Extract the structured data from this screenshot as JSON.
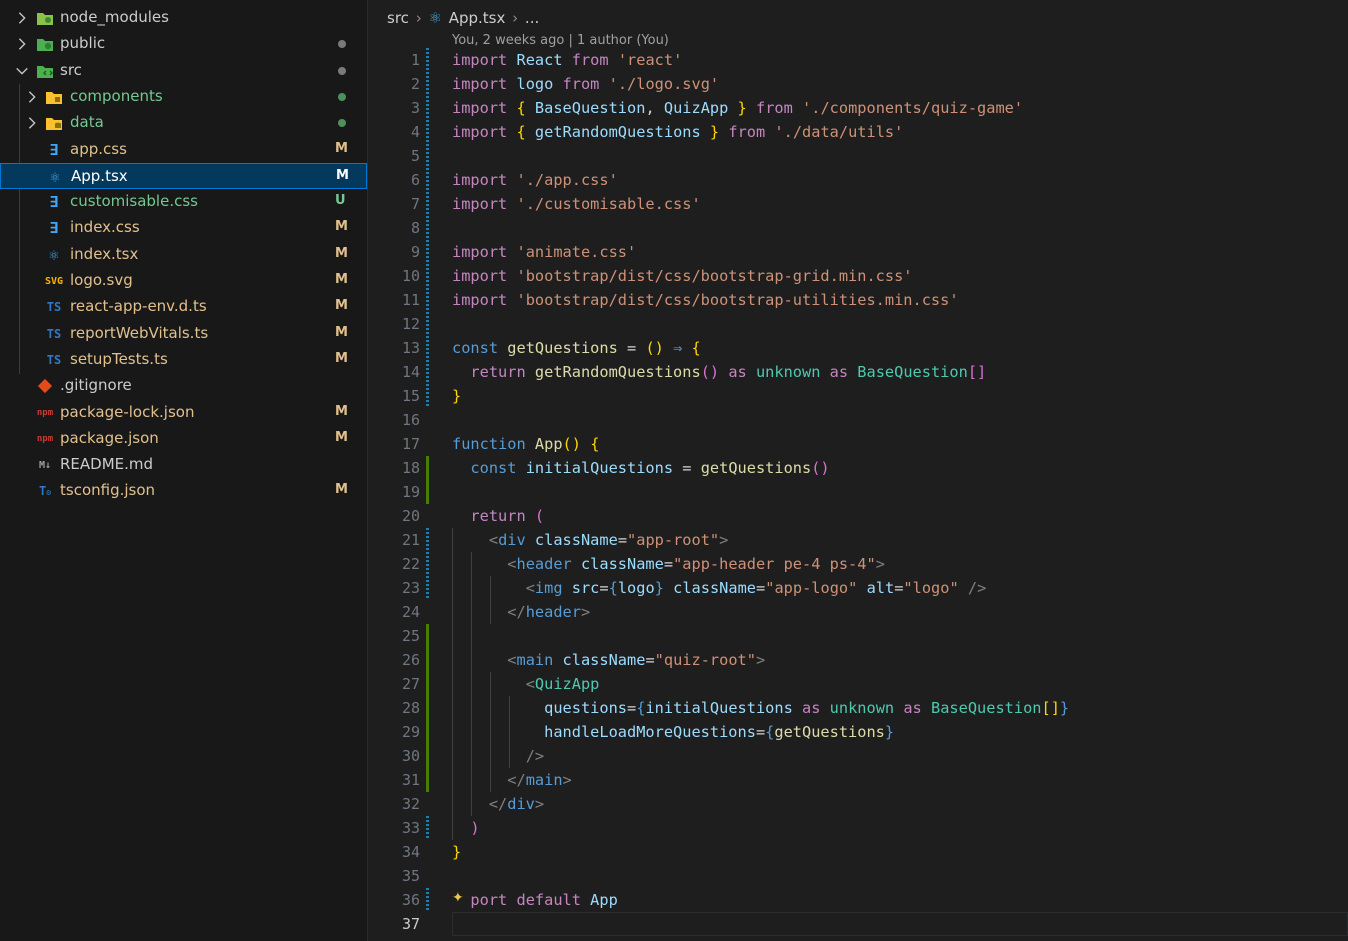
{
  "sidebar": {
    "items": [
      {
        "name": "node_modules",
        "kind": "folder",
        "icon": "folder-node-icon",
        "collapsed": true,
        "badge": "",
        "dot": false
      },
      {
        "name": "public",
        "kind": "folder",
        "icon": "folder-public-icon",
        "collapsed": true,
        "badge": "",
        "dot": true
      },
      {
        "name": "src",
        "kind": "folder",
        "icon": "folder-src-icon",
        "collapsed": false,
        "badge": "",
        "dot": true
      },
      {
        "name": "components",
        "kind": "folder",
        "icon": "folder-components-icon",
        "collapsed": true,
        "badge": "",
        "dot": true
      },
      {
        "name": "data",
        "kind": "folder",
        "icon": "folder-data-icon",
        "collapsed": true,
        "badge": "",
        "dot": true
      },
      {
        "name": "app.css",
        "kind": "file",
        "icon": "css-icon",
        "badge": "M"
      },
      {
        "name": "App.tsx",
        "kind": "file",
        "icon": "react-icon",
        "badge": "M",
        "selected": true
      },
      {
        "name": "customisable.css",
        "kind": "file",
        "icon": "css-icon",
        "badge": "U"
      },
      {
        "name": "index.css",
        "kind": "file",
        "icon": "css-icon",
        "badge": "M"
      },
      {
        "name": "index.tsx",
        "kind": "file",
        "icon": "react-icon",
        "badge": "M"
      },
      {
        "name": "logo.svg",
        "kind": "file",
        "icon": "svg-icon",
        "badge": "M"
      },
      {
        "name": "react-app-env.d.ts",
        "kind": "file",
        "icon": "typescript-icon",
        "badge": "M"
      },
      {
        "name": "reportWebVitals.ts",
        "kind": "file",
        "icon": "typescript-icon",
        "badge": "M"
      },
      {
        "name": "setupTests.ts",
        "kind": "file",
        "icon": "typescript-icon",
        "badge": "M"
      },
      {
        "name": ".gitignore",
        "kind": "file",
        "icon": "git-icon",
        "badge": ""
      },
      {
        "name": "package-lock.json",
        "kind": "file",
        "icon": "npm-icon",
        "badge": "M"
      },
      {
        "name": "package.json",
        "kind": "file",
        "icon": "npm-icon",
        "badge": "M"
      },
      {
        "name": "README.md",
        "kind": "file",
        "icon": "markdown-icon",
        "badge": ""
      },
      {
        "name": "tsconfig.json",
        "kind": "file",
        "icon": "tsconfig-icon",
        "badge": "M"
      }
    ]
  },
  "editor": {
    "breadcrumb": [
      "src",
      "App.tsx",
      "..."
    ],
    "blame": "You, 2 weeks ago | 1 author (You)",
    "active_line": 37,
    "lines": [
      [
        [
          "k",
          "import"
        ],
        [
          "p",
          " "
        ],
        [
          "v",
          "React"
        ],
        [
          "p",
          " "
        ],
        [
          "k",
          "from"
        ],
        [
          "p",
          " "
        ],
        [
          "s",
          "'react'"
        ]
      ],
      [
        [
          "k",
          "import"
        ],
        [
          "p",
          " "
        ],
        [
          "v",
          "logo"
        ],
        [
          "p",
          " "
        ],
        [
          "k",
          "from"
        ],
        [
          "p",
          " "
        ],
        [
          "s",
          "'./logo.svg'"
        ]
      ],
      [
        [
          "k",
          "import"
        ],
        [
          "p",
          " "
        ],
        [
          "y",
          "{"
        ],
        [
          "p",
          " "
        ],
        [
          "v",
          "BaseQuestion"
        ],
        [
          "p",
          ", "
        ],
        [
          "v",
          "QuizApp"
        ],
        [
          "p",
          " "
        ],
        [
          "y",
          "}"
        ],
        [
          "p",
          " "
        ],
        [
          "k",
          "from"
        ],
        [
          "p",
          " "
        ],
        [
          "s",
          "'./components/quiz-game'"
        ]
      ],
      [
        [
          "k",
          "import"
        ],
        [
          "p",
          " "
        ],
        [
          "y",
          "{"
        ],
        [
          "p",
          " "
        ],
        [
          "v",
          "getRandomQuestions"
        ],
        [
          "p",
          " "
        ],
        [
          "y",
          "}"
        ],
        [
          "p",
          " "
        ],
        [
          "k",
          "from"
        ],
        [
          "p",
          " "
        ],
        [
          "s",
          "'./data/utils'"
        ]
      ],
      [],
      [
        [
          "k",
          "import"
        ],
        [
          "p",
          " "
        ],
        [
          "s",
          "'./app.css'"
        ]
      ],
      [
        [
          "k",
          "import"
        ],
        [
          "p",
          " "
        ],
        [
          "s",
          "'./customisable.css'"
        ]
      ],
      [],
      [
        [
          "k",
          "import"
        ],
        [
          "p",
          " "
        ],
        [
          "s",
          "'animate.css'"
        ]
      ],
      [
        [
          "k",
          "import"
        ],
        [
          "p",
          " "
        ],
        [
          "s",
          "'bootstrap/dist/css/bootstrap-grid.min.css'"
        ]
      ],
      [
        [
          "k",
          "import"
        ],
        [
          "p",
          " "
        ],
        [
          "s",
          "'bootstrap/dist/css/bootstrap-utilities.min.css'"
        ]
      ],
      [],
      [
        [
          "b",
          "const"
        ],
        [
          "p",
          " "
        ],
        [
          "f",
          "getQuestions"
        ],
        [
          "p",
          " = "
        ],
        [
          "y",
          "()"
        ],
        [
          "p",
          " "
        ],
        [
          "b",
          "⇒"
        ],
        [
          "p",
          " "
        ],
        [
          "y",
          "{"
        ]
      ],
      [
        [
          "p",
          "  "
        ],
        [
          "k",
          "return"
        ],
        [
          "p",
          " "
        ],
        [
          "f",
          "getRandomQuestions"
        ],
        [
          "m",
          "()"
        ],
        [
          "p",
          " "
        ],
        [
          "k",
          "as"
        ],
        [
          "p",
          " "
        ],
        [
          "t",
          "unknown"
        ],
        [
          "p",
          " "
        ],
        [
          "k",
          "as"
        ],
        [
          "p",
          " "
        ],
        [
          "t",
          "BaseQuestion"
        ],
        [
          "m",
          "[]"
        ]
      ],
      [
        [
          "y",
          "}"
        ]
      ],
      [],
      [
        [
          "b",
          "function"
        ],
        [
          "p",
          " "
        ],
        [
          "f",
          "App"
        ],
        [
          "y",
          "()"
        ],
        [
          "p",
          " "
        ],
        [
          "y",
          "{"
        ]
      ],
      [
        [
          "p",
          "  "
        ],
        [
          "b",
          "const"
        ],
        [
          "p",
          " "
        ],
        [
          "v",
          "initialQuestions"
        ],
        [
          "p",
          " = "
        ],
        [
          "f",
          "getQuestions"
        ],
        [
          "m",
          "()"
        ]
      ],
      [],
      [
        [
          "p",
          "  "
        ],
        [
          "k",
          "return"
        ],
        [
          "p",
          " "
        ],
        [
          "m",
          "("
        ]
      ],
      [
        [
          "p",
          "    "
        ],
        [
          "g",
          "<"
        ],
        [
          "b",
          "div"
        ],
        [
          "p",
          " "
        ],
        [
          "v",
          "className"
        ],
        [
          "p",
          "="
        ],
        [
          "s",
          "\"app-root\""
        ],
        [
          "g",
          ">"
        ]
      ],
      [
        [
          "p",
          "      "
        ],
        [
          "g",
          "<"
        ],
        [
          "b",
          "header"
        ],
        [
          "p",
          " "
        ],
        [
          "v",
          "className"
        ],
        [
          "p",
          "="
        ],
        [
          "s",
          "\"app-header pe-4 ps-4\""
        ],
        [
          "g",
          ">"
        ]
      ],
      [
        [
          "p",
          "        "
        ],
        [
          "g",
          "<"
        ],
        [
          "b",
          "img"
        ],
        [
          "p",
          " "
        ],
        [
          "v",
          "src"
        ],
        [
          "p",
          "="
        ],
        [
          "b",
          "{"
        ],
        [
          "v",
          "logo"
        ],
        [
          "b",
          "}"
        ],
        [
          "p",
          " "
        ],
        [
          "v",
          "className"
        ],
        [
          "p",
          "="
        ],
        [
          "s",
          "\"app-logo\""
        ],
        [
          "p",
          " "
        ],
        [
          "v",
          "alt"
        ],
        [
          "p",
          "="
        ],
        [
          "s",
          "\"logo\""
        ],
        [
          "p",
          " "
        ],
        [
          "g",
          "/>"
        ]
      ],
      [
        [
          "p",
          "      "
        ],
        [
          "g",
          "</"
        ],
        [
          "b",
          "header"
        ],
        [
          "g",
          ">"
        ]
      ],
      [],
      [
        [
          "p",
          "      "
        ],
        [
          "g",
          "<"
        ],
        [
          "b",
          "main"
        ],
        [
          "p",
          " "
        ],
        [
          "v",
          "className"
        ],
        [
          "p",
          "="
        ],
        [
          "s",
          "\"quiz-root\""
        ],
        [
          "g",
          ">"
        ]
      ],
      [
        [
          "p",
          "        "
        ],
        [
          "g",
          "<"
        ],
        [
          "t",
          "QuizApp"
        ]
      ],
      [
        [
          "p",
          "          "
        ],
        [
          "v",
          "questions"
        ],
        [
          "p",
          "="
        ],
        [
          "b",
          "{"
        ],
        [
          "v",
          "initialQuestions"
        ],
        [
          "p",
          " "
        ],
        [
          "k",
          "as"
        ],
        [
          "p",
          " "
        ],
        [
          "t",
          "unknown"
        ],
        [
          "p",
          " "
        ],
        [
          "k",
          "as"
        ],
        [
          "p",
          " "
        ],
        [
          "t",
          "BaseQuestion"
        ],
        [
          "y",
          "[]"
        ],
        [
          "b",
          "}"
        ]
      ],
      [
        [
          "p",
          "          "
        ],
        [
          "v",
          "handleLoadMoreQuestions"
        ],
        [
          "p",
          "="
        ],
        [
          "b",
          "{"
        ],
        [
          "f",
          "getQuestions"
        ],
        [
          "b",
          "}"
        ]
      ],
      [
        [
          "p",
          "        "
        ],
        [
          "g",
          "/>"
        ]
      ],
      [
        [
          "p",
          "      "
        ],
        [
          "g",
          "</"
        ],
        [
          "b",
          "main"
        ],
        [
          "g",
          ">"
        ]
      ],
      [
        [
          "p",
          "    "
        ],
        [
          "g",
          "</"
        ],
        [
          "b",
          "div"
        ],
        [
          "g",
          ">"
        ]
      ],
      [
        [
          "p",
          "  "
        ],
        [
          "m",
          ")"
        ]
      ],
      [
        [
          "y",
          "}"
        ]
      ],
      [],
      [
        [
          "p",
          "  "
        ],
        [
          "k",
          "port"
        ],
        [
          "p",
          " "
        ],
        [
          "k",
          "default"
        ],
        [
          "p",
          " "
        ],
        [
          "v",
          "App"
        ]
      ],
      []
    ],
    "gutter": [
      "mod",
      "mod",
      "mod",
      "mod",
      "mod",
      "mod",
      "mod",
      "mod",
      "mod",
      "mod",
      "mod",
      "mod",
      "mod",
      "mod",
      "mod",
      "",
      "",
      "add",
      "add",
      "",
      "mod",
      "mod",
      "mod",
      "",
      "add",
      "add",
      "add",
      "add",
      "add",
      "add",
      "add",
      "",
      "mod",
      "",
      "",
      "mod",
      ""
    ],
    "colors": {
      "accent": "#0078d4",
      "modified": "#1b81a8",
      "added": "#487e02",
      "badge_m": "#e2c08d",
      "badge_u": "#73c991"
    }
  }
}
